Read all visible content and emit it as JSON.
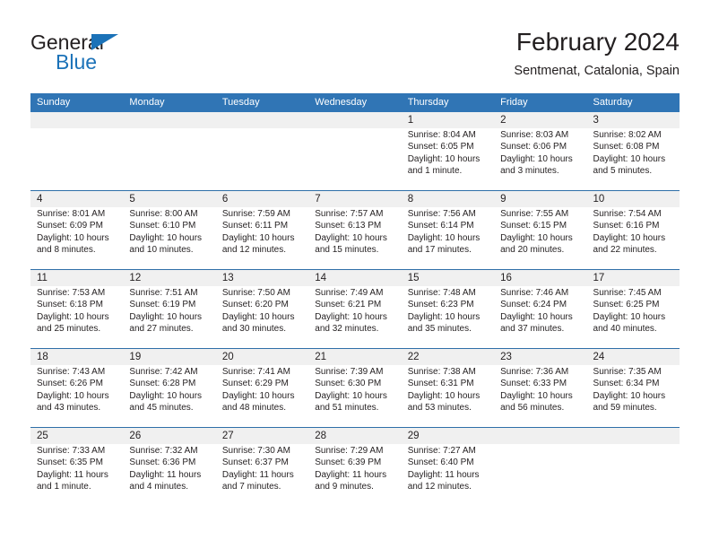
{
  "brand": {
    "word1": "General",
    "word2": "Blue",
    "triangle_color": "#1b72b8"
  },
  "header": {
    "title": "February 2024",
    "subtitle": "Sentmenat, Catalonia, Spain"
  },
  "theme": {
    "header_bar": "#3075b5",
    "row_divider": "#2f6fa8",
    "date_band": "#f0f0f0",
    "text": "#231f20"
  },
  "weekdays": [
    "Sunday",
    "Monday",
    "Tuesday",
    "Wednesday",
    "Thursday",
    "Friday",
    "Saturday"
  ],
  "weeks": [
    [
      {
        "day": "",
        "sunrise": "",
        "sunset": "",
        "daylight1": "",
        "daylight2": ""
      },
      {
        "day": "",
        "sunrise": "",
        "sunset": "",
        "daylight1": "",
        "daylight2": ""
      },
      {
        "day": "",
        "sunrise": "",
        "sunset": "",
        "daylight1": "",
        "daylight2": ""
      },
      {
        "day": "",
        "sunrise": "",
        "sunset": "",
        "daylight1": "",
        "daylight2": ""
      },
      {
        "day": "1",
        "sunrise": "Sunrise: 8:04 AM",
        "sunset": "Sunset: 6:05 PM",
        "daylight1": "Daylight: 10 hours",
        "daylight2": "and 1 minute."
      },
      {
        "day": "2",
        "sunrise": "Sunrise: 8:03 AM",
        "sunset": "Sunset: 6:06 PM",
        "daylight1": "Daylight: 10 hours",
        "daylight2": "and 3 minutes."
      },
      {
        "day": "3",
        "sunrise": "Sunrise: 8:02 AM",
        "sunset": "Sunset: 6:08 PM",
        "daylight1": "Daylight: 10 hours",
        "daylight2": "and 5 minutes."
      }
    ],
    [
      {
        "day": "4",
        "sunrise": "Sunrise: 8:01 AM",
        "sunset": "Sunset: 6:09 PM",
        "daylight1": "Daylight: 10 hours",
        "daylight2": "and 8 minutes."
      },
      {
        "day": "5",
        "sunrise": "Sunrise: 8:00 AM",
        "sunset": "Sunset: 6:10 PM",
        "daylight1": "Daylight: 10 hours",
        "daylight2": "and 10 minutes."
      },
      {
        "day": "6",
        "sunrise": "Sunrise: 7:59 AM",
        "sunset": "Sunset: 6:11 PM",
        "daylight1": "Daylight: 10 hours",
        "daylight2": "and 12 minutes."
      },
      {
        "day": "7",
        "sunrise": "Sunrise: 7:57 AM",
        "sunset": "Sunset: 6:13 PM",
        "daylight1": "Daylight: 10 hours",
        "daylight2": "and 15 minutes."
      },
      {
        "day": "8",
        "sunrise": "Sunrise: 7:56 AM",
        "sunset": "Sunset: 6:14 PM",
        "daylight1": "Daylight: 10 hours",
        "daylight2": "and 17 minutes."
      },
      {
        "day": "9",
        "sunrise": "Sunrise: 7:55 AM",
        "sunset": "Sunset: 6:15 PM",
        "daylight1": "Daylight: 10 hours",
        "daylight2": "and 20 minutes."
      },
      {
        "day": "10",
        "sunrise": "Sunrise: 7:54 AM",
        "sunset": "Sunset: 6:16 PM",
        "daylight1": "Daylight: 10 hours",
        "daylight2": "and 22 minutes."
      }
    ],
    [
      {
        "day": "11",
        "sunrise": "Sunrise: 7:53 AM",
        "sunset": "Sunset: 6:18 PM",
        "daylight1": "Daylight: 10 hours",
        "daylight2": "and 25 minutes."
      },
      {
        "day": "12",
        "sunrise": "Sunrise: 7:51 AM",
        "sunset": "Sunset: 6:19 PM",
        "daylight1": "Daylight: 10 hours",
        "daylight2": "and 27 minutes."
      },
      {
        "day": "13",
        "sunrise": "Sunrise: 7:50 AM",
        "sunset": "Sunset: 6:20 PM",
        "daylight1": "Daylight: 10 hours",
        "daylight2": "and 30 minutes."
      },
      {
        "day": "14",
        "sunrise": "Sunrise: 7:49 AM",
        "sunset": "Sunset: 6:21 PM",
        "daylight1": "Daylight: 10 hours",
        "daylight2": "and 32 minutes."
      },
      {
        "day": "15",
        "sunrise": "Sunrise: 7:48 AM",
        "sunset": "Sunset: 6:23 PM",
        "daylight1": "Daylight: 10 hours",
        "daylight2": "and 35 minutes."
      },
      {
        "day": "16",
        "sunrise": "Sunrise: 7:46 AM",
        "sunset": "Sunset: 6:24 PM",
        "daylight1": "Daylight: 10 hours",
        "daylight2": "and 37 minutes."
      },
      {
        "day": "17",
        "sunrise": "Sunrise: 7:45 AM",
        "sunset": "Sunset: 6:25 PM",
        "daylight1": "Daylight: 10 hours",
        "daylight2": "and 40 minutes."
      }
    ],
    [
      {
        "day": "18",
        "sunrise": "Sunrise: 7:43 AM",
        "sunset": "Sunset: 6:26 PM",
        "daylight1": "Daylight: 10 hours",
        "daylight2": "and 43 minutes."
      },
      {
        "day": "19",
        "sunrise": "Sunrise: 7:42 AM",
        "sunset": "Sunset: 6:28 PM",
        "daylight1": "Daylight: 10 hours",
        "daylight2": "and 45 minutes."
      },
      {
        "day": "20",
        "sunrise": "Sunrise: 7:41 AM",
        "sunset": "Sunset: 6:29 PM",
        "daylight1": "Daylight: 10 hours",
        "daylight2": "and 48 minutes."
      },
      {
        "day": "21",
        "sunrise": "Sunrise: 7:39 AM",
        "sunset": "Sunset: 6:30 PM",
        "daylight1": "Daylight: 10 hours",
        "daylight2": "and 51 minutes."
      },
      {
        "day": "22",
        "sunrise": "Sunrise: 7:38 AM",
        "sunset": "Sunset: 6:31 PM",
        "daylight1": "Daylight: 10 hours",
        "daylight2": "and 53 minutes."
      },
      {
        "day": "23",
        "sunrise": "Sunrise: 7:36 AM",
        "sunset": "Sunset: 6:33 PM",
        "daylight1": "Daylight: 10 hours",
        "daylight2": "and 56 minutes."
      },
      {
        "day": "24",
        "sunrise": "Sunrise: 7:35 AM",
        "sunset": "Sunset: 6:34 PM",
        "daylight1": "Daylight: 10 hours",
        "daylight2": "and 59 minutes."
      }
    ],
    [
      {
        "day": "25",
        "sunrise": "Sunrise: 7:33 AM",
        "sunset": "Sunset: 6:35 PM",
        "daylight1": "Daylight: 11 hours",
        "daylight2": "and 1 minute."
      },
      {
        "day": "26",
        "sunrise": "Sunrise: 7:32 AM",
        "sunset": "Sunset: 6:36 PM",
        "daylight1": "Daylight: 11 hours",
        "daylight2": "and 4 minutes."
      },
      {
        "day": "27",
        "sunrise": "Sunrise: 7:30 AM",
        "sunset": "Sunset: 6:37 PM",
        "daylight1": "Daylight: 11 hours",
        "daylight2": "and 7 minutes."
      },
      {
        "day": "28",
        "sunrise": "Sunrise: 7:29 AM",
        "sunset": "Sunset: 6:39 PM",
        "daylight1": "Daylight: 11 hours",
        "daylight2": "and 9 minutes."
      },
      {
        "day": "29",
        "sunrise": "Sunrise: 7:27 AM",
        "sunset": "Sunset: 6:40 PM",
        "daylight1": "Daylight: 11 hours",
        "daylight2": "and 12 minutes."
      },
      {
        "day": "",
        "sunrise": "",
        "sunset": "",
        "daylight1": "",
        "daylight2": ""
      },
      {
        "day": "",
        "sunrise": "",
        "sunset": "",
        "daylight1": "",
        "daylight2": ""
      }
    ]
  ]
}
